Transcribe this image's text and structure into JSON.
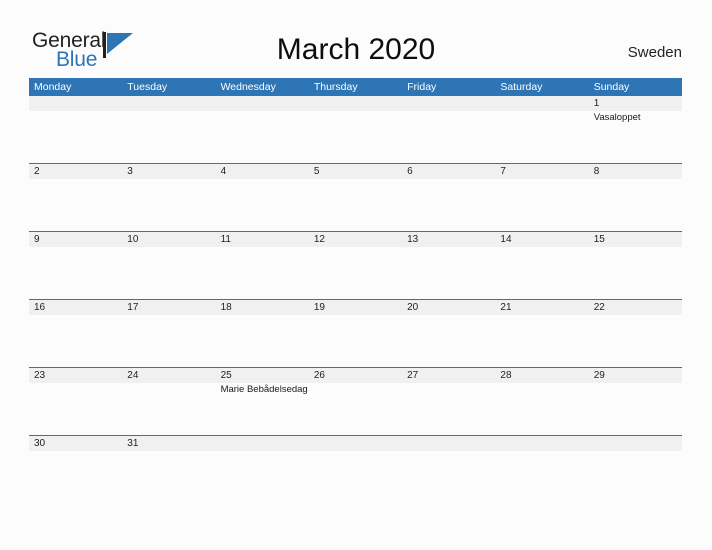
{
  "brand": {
    "name_part1": "General",
    "name_part2": "Blue",
    "mark_icon": "triangle-flag-icon",
    "color_dark": "#231f20",
    "color_blue": "#2e75b6"
  },
  "header": {
    "title": "March 2020",
    "country": "Sweden"
  },
  "theme": {
    "accent": "#2e75b6",
    "date_strip": "#f0f0f0",
    "page_background": "#fcfcfd",
    "header_text": "#ffffff"
  },
  "calendar": {
    "weekday_headers": [
      "Monday",
      "Tuesday",
      "Wednesday",
      "Thursday",
      "Friday",
      "Saturday",
      "Sunday"
    ],
    "weeks": [
      {
        "days": [
          {
            "date": "",
            "events": []
          },
          {
            "date": "",
            "events": []
          },
          {
            "date": "",
            "events": []
          },
          {
            "date": "",
            "events": []
          },
          {
            "date": "",
            "events": []
          },
          {
            "date": "",
            "events": []
          },
          {
            "date": "1",
            "events": [
              "Vasaloppet"
            ]
          }
        ]
      },
      {
        "days": [
          {
            "date": "2",
            "events": []
          },
          {
            "date": "3",
            "events": []
          },
          {
            "date": "4",
            "events": []
          },
          {
            "date": "5",
            "events": []
          },
          {
            "date": "6",
            "events": []
          },
          {
            "date": "7",
            "events": []
          },
          {
            "date": "8",
            "events": []
          }
        ]
      },
      {
        "days": [
          {
            "date": "9",
            "events": []
          },
          {
            "date": "10",
            "events": []
          },
          {
            "date": "11",
            "events": []
          },
          {
            "date": "12",
            "events": []
          },
          {
            "date": "13",
            "events": []
          },
          {
            "date": "14",
            "events": []
          },
          {
            "date": "15",
            "events": []
          }
        ]
      },
      {
        "days": [
          {
            "date": "16",
            "events": []
          },
          {
            "date": "17",
            "events": []
          },
          {
            "date": "18",
            "events": []
          },
          {
            "date": "19",
            "events": []
          },
          {
            "date": "20",
            "events": []
          },
          {
            "date": "21",
            "events": []
          },
          {
            "date": "22",
            "events": []
          }
        ]
      },
      {
        "days": [
          {
            "date": "23",
            "events": []
          },
          {
            "date": "24",
            "events": []
          },
          {
            "date": "25",
            "events": [
              "Marie Bebådelsedag"
            ]
          },
          {
            "date": "26",
            "events": []
          },
          {
            "date": "27",
            "events": []
          },
          {
            "date": "28",
            "events": []
          },
          {
            "date": "29",
            "events": []
          }
        ]
      },
      {
        "short": true,
        "days": [
          {
            "date": "30",
            "events": []
          },
          {
            "date": "31",
            "events": []
          },
          {
            "date": "",
            "events": []
          },
          {
            "date": "",
            "events": []
          },
          {
            "date": "",
            "events": []
          },
          {
            "date": "",
            "events": []
          },
          {
            "date": "",
            "events": []
          }
        ]
      }
    ]
  }
}
